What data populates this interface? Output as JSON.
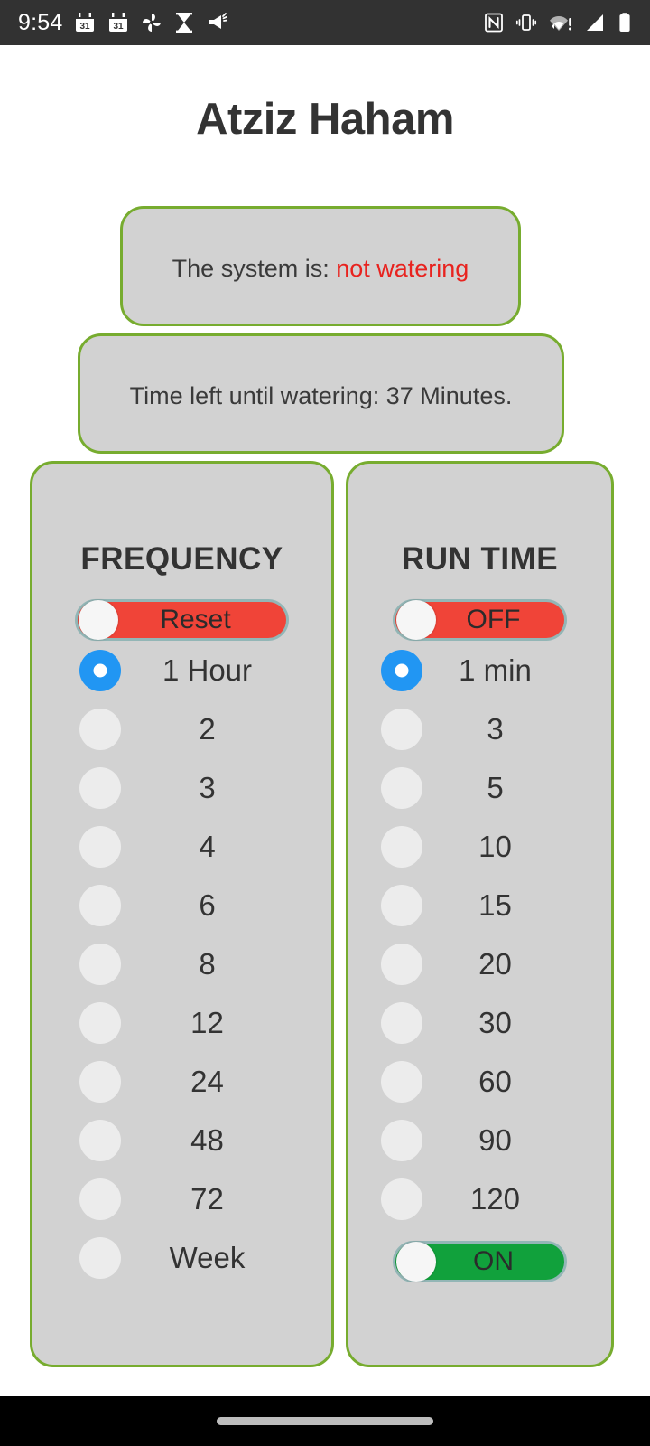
{
  "status_bar": {
    "time": "9:54",
    "left_icons": [
      {
        "name": "calendar-icon",
        "label": "31"
      },
      {
        "name": "calendar-icon",
        "label": "31"
      },
      {
        "name": "pinwheel-icon",
        "label": ""
      },
      {
        "name": "hourglass-icon",
        "label": ""
      },
      {
        "name": "megaphone-icon",
        "label": ""
      }
    ],
    "right_icons": [
      {
        "name": "nfc-icon",
        "label": ""
      },
      {
        "name": "vibrate-icon",
        "label": ""
      },
      {
        "name": "wifi-warning-icon",
        "label": ""
      },
      {
        "name": "cellular-signal-icon",
        "label": ""
      },
      {
        "name": "battery-icon",
        "label": ""
      }
    ]
  },
  "header": {
    "title": "Atziz Haham"
  },
  "status_card": {
    "prefix": "The system is: ",
    "state": "not watering",
    "state_color": "#e8231f"
  },
  "timer_card": {
    "text": "Time left until watering: 37 Minutes."
  },
  "theme": {
    "panel_border": "#77ac2f",
    "panel_fill": "#d2d2d2",
    "accent_blue": "#2196f3",
    "toggle_red": "#f04438",
    "toggle_green": "#11a13c",
    "toggle_border": "#93b6b6",
    "text": "#333333"
  },
  "frequency_panel": {
    "title": "FREQUENCY",
    "reset_toggle": {
      "label": "Reset",
      "state": "off",
      "color": "#f04438"
    },
    "options": [
      {
        "label": "1 Hour",
        "selected": true
      },
      {
        "label": "2",
        "selected": false
      },
      {
        "label": "3",
        "selected": false
      },
      {
        "label": "4",
        "selected": false
      },
      {
        "label": "6",
        "selected": false
      },
      {
        "label": "8",
        "selected": false
      },
      {
        "label": "12",
        "selected": false
      },
      {
        "label": "24",
        "selected": false
      },
      {
        "label": "48",
        "selected": false
      },
      {
        "label": "72",
        "selected": false
      },
      {
        "label": "Week",
        "selected": false
      }
    ]
  },
  "runtime_panel": {
    "title": "RUN TIME",
    "off_toggle": {
      "label": "OFF",
      "state": "off",
      "color": "#f04438"
    },
    "on_toggle": {
      "label": "ON",
      "state": "off",
      "color": "#11a13c"
    },
    "options": [
      {
        "label": "1 min",
        "selected": true
      },
      {
        "label": "3",
        "selected": false
      },
      {
        "label": "5",
        "selected": false
      },
      {
        "label": "10",
        "selected": false
      },
      {
        "label": "15",
        "selected": false
      },
      {
        "label": "20",
        "selected": false
      },
      {
        "label": "30",
        "selected": false
      },
      {
        "label": "60",
        "selected": false
      },
      {
        "label": "90",
        "selected": false
      },
      {
        "label": "120",
        "selected": false
      }
    ]
  },
  "navigation_bar": {
    "gesture_pill": "home-gesture-pill"
  }
}
